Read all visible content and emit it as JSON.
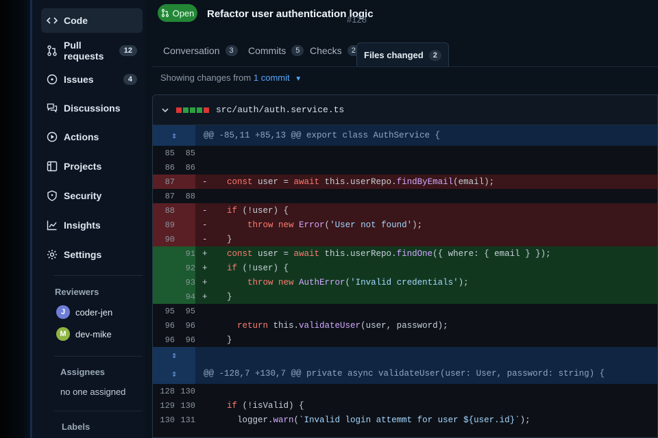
{
  "sidebar": {
    "items": [
      {
        "label": "Code",
        "count": "",
        "icon": "code-icon"
      },
      {
        "label": "Pull requests",
        "count": "12",
        "icon": "git-pull-request-icon"
      },
      {
        "label": "Issues",
        "count": "4",
        "icon": "issue-icon"
      },
      {
        "label": "Discussions",
        "count": "",
        "icon": "discussion-icon"
      },
      {
        "label": "Actions",
        "count": "",
        "icon": "play-icon"
      },
      {
        "label": "Projects",
        "count": "",
        "icon": "table-icon"
      },
      {
        "label": "Security",
        "count": "",
        "icon": "shield-icon"
      },
      {
        "label": "Insights",
        "count": "",
        "icon": "graph-icon"
      },
      {
        "label": "Settings",
        "count": "",
        "icon": "gear-icon"
      }
    ],
    "reviewers_heading": "Reviewers",
    "reviewers": [
      {
        "initial": "J",
        "name": "coder-jen",
        "color": "#6e7ed8"
      },
      {
        "initial": "M",
        "name": "dev-mike",
        "color": "#8fb543"
      }
    ],
    "assignees_heading": "Assignees",
    "assignees_value": "no one assigned",
    "labels_heading": "Labels"
  },
  "pr": {
    "status": "Open",
    "title": "Refactor user authentication logic",
    "number": "#128"
  },
  "tabs": [
    {
      "label": "Conversation",
      "count": "3"
    },
    {
      "label": "Commits",
      "count": "5"
    },
    {
      "label": "Checks",
      "count": "2"
    },
    {
      "label": "Files changed",
      "count": "2"
    }
  ],
  "showing": {
    "prefix": "Showing changes from",
    "link": "1 commit"
  },
  "file": {
    "path": "src/auth/auth.service.ts",
    "diffstat_colors": [
      "#da3633",
      "#2ea043",
      "#2ea043",
      "#2ea043",
      "#da3633"
    ]
  },
  "diff_rows": [
    {
      "type": "hunk",
      "text": "@@ -85,11 +85,13 @@ export class AuthService {"
    },
    {
      "type": "ctx",
      "old": "85",
      "new": "85",
      "sign": "",
      "tokens": []
    },
    {
      "type": "ctx",
      "old": "86",
      "new": "86",
      "sign": "",
      "tokens": []
    },
    {
      "type": "del",
      "old": "87",
      "new": "",
      "sign": "-",
      "tokens": [
        {
          "c": "kw",
          "t": "const "
        },
        {
          "c": "pl",
          "t": "user = "
        },
        {
          "c": "kw",
          "t": "await "
        },
        {
          "c": "pl",
          "t": "this.userRepo."
        },
        {
          "c": "fn",
          "t": "findByEmail"
        },
        {
          "c": "pl",
          "t": "(email);"
        }
      ]
    },
    {
      "type": "ctx",
      "old": "87",
      "new": "88",
      "sign": "",
      "tokens": []
    },
    {
      "type": "del",
      "old": "88",
      "new": "",
      "sign": "-",
      "tokens": [
        {
          "c": "kw",
          "t": "if "
        },
        {
          "c": "pl",
          "t": "(!user) {"
        }
      ]
    },
    {
      "type": "del",
      "old": "89",
      "new": "",
      "sign": "-",
      "tokens": [
        {
          "c": "pl",
          "t": "    "
        },
        {
          "c": "kw",
          "t": "throw new "
        },
        {
          "c": "fn",
          "t": "Error"
        },
        {
          "c": "pl",
          "t": "("
        },
        {
          "c": "str",
          "t": "'User not found'"
        },
        {
          "c": "pl",
          "t": ");"
        }
      ]
    },
    {
      "type": "del",
      "old": "90",
      "new": "",
      "sign": "-",
      "tokens": [
        {
          "c": "pl",
          "t": "}"
        }
      ]
    },
    {
      "type": "add",
      "old": "",
      "new": "91",
      "sign": "+",
      "tokens": [
        {
          "c": "kw",
          "t": "const "
        },
        {
          "c": "pl",
          "t": "user = "
        },
        {
          "c": "kw",
          "t": "await "
        },
        {
          "c": "pl",
          "t": "this.userRepo."
        },
        {
          "c": "fn",
          "t": "findOne"
        },
        {
          "c": "pl",
          "t": "({ where: { email } });"
        }
      ]
    },
    {
      "type": "add",
      "old": "",
      "new": "92",
      "sign": "+",
      "tokens": [
        {
          "c": "kw",
          "t": "if "
        },
        {
          "c": "pl",
          "t": "(!user) {"
        }
      ]
    },
    {
      "type": "add",
      "old": "",
      "new": "93",
      "sign": "+",
      "tokens": [
        {
          "c": "pl",
          "t": "    "
        },
        {
          "c": "kw",
          "t": "throw new "
        },
        {
          "c": "fn",
          "t": "AuthError"
        },
        {
          "c": "pl",
          "t": "("
        },
        {
          "c": "str",
          "t": "'Invalid credentials'"
        },
        {
          "c": "pl",
          "t": ");"
        }
      ]
    },
    {
      "type": "add",
      "old": "",
      "new": "94",
      "sign": "+",
      "tokens": [
        {
          "c": "pl",
          "t": "}"
        }
      ]
    },
    {
      "type": "ctx",
      "old": "95",
      "new": "95",
      "sign": "",
      "tokens": []
    },
    {
      "type": "ctx",
      "old": "96",
      "new": "96",
      "sign": "",
      "tokens": [
        {
          "c": "pl",
          "t": "  "
        },
        {
          "c": "kw",
          "t": "return "
        },
        {
          "c": "pl",
          "t": "this."
        },
        {
          "c": "fn",
          "t": "validateUser"
        },
        {
          "c": "pl",
          "t": "(user, password);"
        }
      ]
    },
    {
      "type": "ctx",
      "old": "96",
      "new": "96",
      "sign": "",
      "tokens": [
        {
          "c": "pl",
          "t": "}"
        }
      ]
    },
    {
      "type": "expand",
      "text": ""
    },
    {
      "type": "hunk",
      "text": "@@ -128,7 +130,7 @@ private async validateUser(user: User, password: string) {"
    },
    {
      "type": "ctx",
      "old": "128",
      "new": "130",
      "sign": "",
      "tokens": []
    },
    {
      "type": "ctx",
      "old": "129",
      "new": "130",
      "sign": "",
      "tokens": [
        {
          "c": "kw",
          "t": "if "
        },
        {
          "c": "pl",
          "t": "(!isValid) {"
        }
      ]
    },
    {
      "type": "ctx",
      "old": "130",
      "new": "131",
      "sign": "",
      "tokens": [
        {
          "c": "pl",
          "t": "  logger."
        },
        {
          "c": "fn",
          "t": "warn"
        },
        {
          "c": "pl",
          "t": "("
        },
        {
          "c": "str",
          "t": "`Invalid login attemmt for user ${user.id}`"
        },
        {
          "c": "pl",
          "t": ");"
        }
      ]
    }
  ]
}
